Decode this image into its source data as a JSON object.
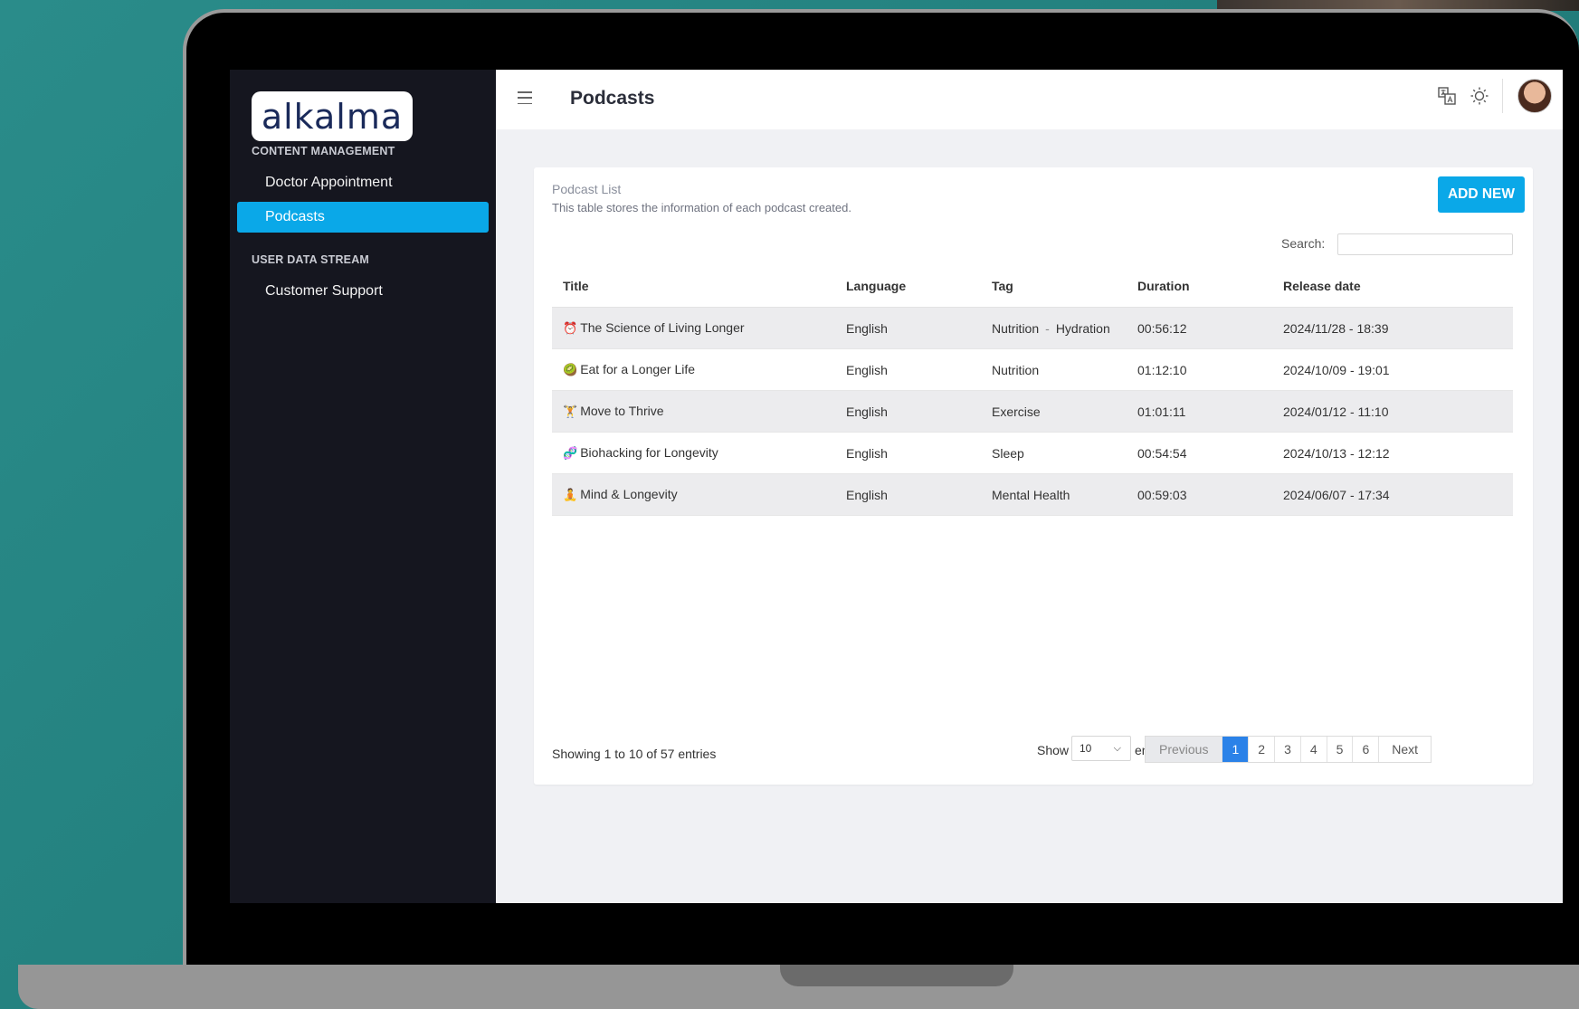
{
  "brand": {
    "logo_text": "alkalma"
  },
  "sidebar": {
    "sections": [
      {
        "label": "CONTENT MANAGEMENT",
        "items": [
          "Doctor Appointment",
          "Podcasts"
        ]
      },
      {
        "label": "USER DATA STREAM",
        "items": [
          "Customer Support"
        ]
      }
    ],
    "active_item": "Podcasts"
  },
  "header": {
    "title": "Podcasts"
  },
  "card": {
    "title": "Podcast List",
    "subtitle": "This table stores the information of each podcast created.",
    "add_button": "ADD NEW",
    "search_label": "Search:",
    "search_value": ""
  },
  "table": {
    "columns": [
      "Title",
      "Language",
      "Tag",
      "Duration",
      "Release date"
    ],
    "rows": [
      {
        "emoji": "⏰",
        "title": "The Science of Living Longer",
        "language": "English",
        "tags": [
          "Nutrition",
          "Hydration"
        ],
        "duration": "00:56:12",
        "release": "2024/11/28 - 18:39"
      },
      {
        "emoji": "🥝",
        "title": "Eat for a Longer Life",
        "language": "English",
        "tags": [
          "Nutrition"
        ],
        "duration": "01:12:10",
        "release": "2024/10/09 - 19:01"
      },
      {
        "emoji": "🏋",
        "title": "Move to Thrive",
        "language": "English",
        "tags": [
          "Exercise"
        ],
        "duration": "01:01:11",
        "release": "2024/01/12 - 11:10"
      },
      {
        "emoji": "🧬",
        "title": "Biohacking for Longevity",
        "language": "English",
        "tags": [
          "Sleep"
        ],
        "duration": "00:54:54",
        "release": "2024/10/13 - 12:12"
      },
      {
        "emoji": "🧘",
        "title": "Mind & Longevity",
        "language": "English",
        "tags": [
          "Mental Health"
        ],
        "duration": "00:59:03",
        "release": "2024/06/07 - 17:34"
      }
    ]
  },
  "footer": {
    "showing": "Showing 1 to 10 of 57 entries",
    "show_label": "Show",
    "page_size": "10",
    "entries_label": "entries",
    "pagination": {
      "previous": "Previous",
      "pages": [
        "1",
        "2",
        "3",
        "4",
        "5",
        "6"
      ],
      "active": "1",
      "next": "Next"
    }
  },
  "icons": [
    "menu-icon",
    "translate-icon",
    "sun-icon",
    "chevron-down-icon"
  ],
  "colors": {
    "accent": "#0aa8e8",
    "active_page": "#2b82e8",
    "sidebar_bg": "#15161f",
    "background": "#2a8c8a"
  }
}
